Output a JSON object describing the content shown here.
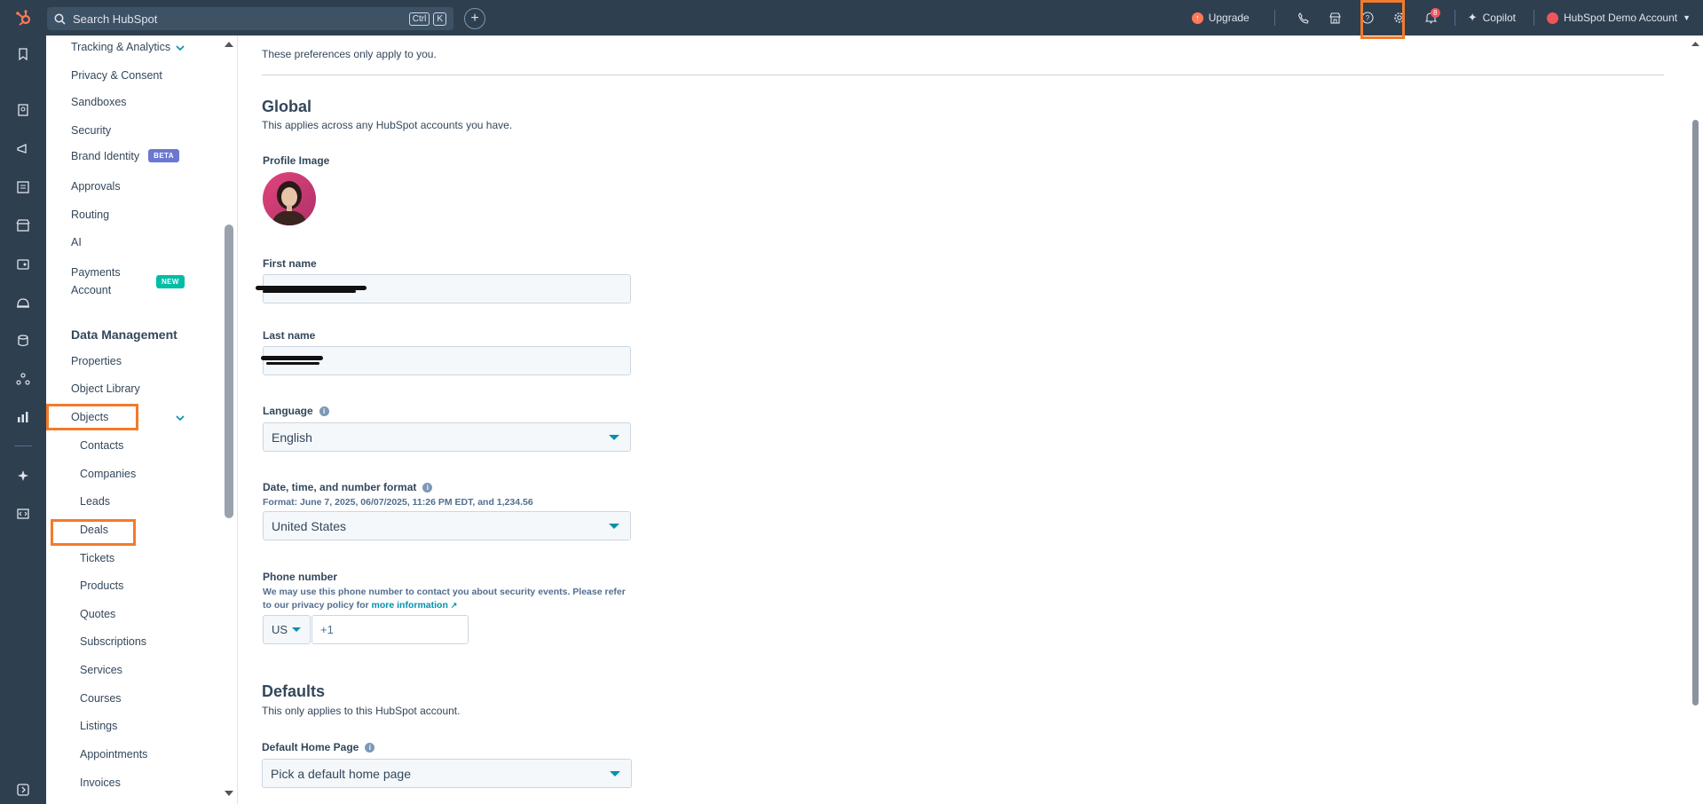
{
  "topbar": {
    "search_placeholder": "Search HubSpot",
    "kbd_ctrl": "Ctrl",
    "kbd_k": "K",
    "upgrade_label": "Upgrade",
    "notification_count": "8",
    "copilot_label": "Copilot",
    "account_label": "HubSpot Demo Account"
  },
  "sidebar": {
    "tracking": "Tracking & Analytics",
    "privacy": "Privacy & Consent",
    "sandboxes": "Sandboxes",
    "security": "Security",
    "brand_identity": "Brand Identity",
    "beta_badge": "BETA",
    "approvals": "Approvals",
    "routing": "Routing",
    "ai": "AI",
    "payments_line1": "Payments",
    "payments_line2": "Account",
    "new_badge": "NEW",
    "data_management": "Data Management",
    "properties": "Properties",
    "object_library": "Object Library",
    "objects": "Objects",
    "objects_items": [
      "Contacts",
      "Companies",
      "Leads",
      "Deals",
      "Tickets",
      "Products",
      "Quotes",
      "Subscriptions",
      "Services",
      "Courses",
      "Listings",
      "Appointments",
      "Invoices"
    ]
  },
  "main": {
    "intro": "These preferences only apply to you.",
    "global_title": "Global",
    "global_desc": "This applies across any HubSpot accounts you have.",
    "profile_image_label": "Profile Image",
    "first_name_label": "First name",
    "last_name_label": "Last name",
    "language_label": "Language",
    "language_value": "English",
    "date_format_label": "Date, time, and number format",
    "date_format_example": "Format: June 7, 2025, 06/07/2025, 11:26 PM EDT, and 1,234.56",
    "date_format_value": "United States",
    "phone_label": "Phone number",
    "phone_desc_line1": "We may use this phone number to contact you about security events. Please refer",
    "phone_desc_line2": "to our privacy policy for",
    "phone_link": "more information",
    "phone_country": "US",
    "phone_value": "+1",
    "defaults_title": "Defaults",
    "defaults_desc": "This only applies to this HubSpot account.",
    "home_page_label": "Default Home Page",
    "home_page_placeholder": "Pick a default home page"
  },
  "colors": {
    "nav_bg": "#2e3f50",
    "highlight": "#f27b2b",
    "accent": "#0091ae"
  }
}
